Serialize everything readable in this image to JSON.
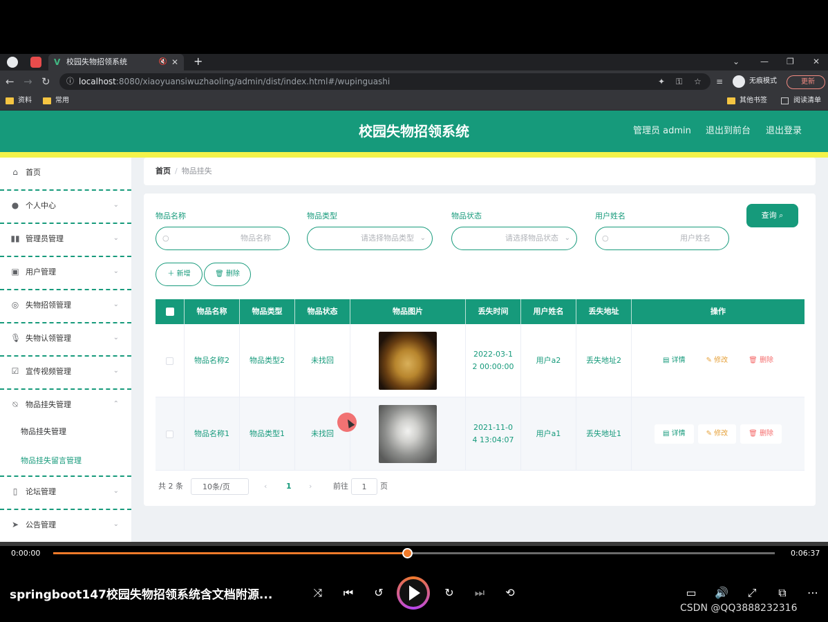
{
  "browser": {
    "tab_title": "校园失物招领系统",
    "url_host": "localhost",
    "url_rest": ":8080/xiaoyuansiwuzhaoling/admin/dist/index.html#/wupinguashi",
    "incognito_label": "无痕模式",
    "update_label": "更新",
    "bookmarks": [
      "资料",
      "常用"
    ],
    "bookmarks_right": [
      "其他书签",
      "阅读清单"
    ]
  },
  "header": {
    "title": "校园失物招领系统",
    "admin_label": "管理员 admin",
    "to_front_label": "退出到前台",
    "logout_label": "退出登录"
  },
  "sidebar": {
    "items": [
      {
        "label": "首页",
        "icon": "home-icon"
      },
      {
        "label": "个人中心",
        "icon": "user-icon"
      },
      {
        "label": "管理员管理",
        "icon": "bars-icon"
      },
      {
        "label": "用户管理",
        "icon": "clipboard-icon"
      },
      {
        "label": "失物招领管理",
        "icon": "target-icon"
      },
      {
        "label": "失物认领管理",
        "icon": "mic-icon"
      },
      {
        "label": "宣传视频管理",
        "icon": "checklist-icon"
      },
      {
        "label": "物品挂失管理",
        "icon": "bell-off-icon"
      },
      {
        "label": "论坛管理",
        "icon": "phone-icon"
      },
      {
        "label": "公告管理",
        "icon": "send-icon"
      }
    ],
    "sub_items": [
      "物品挂失管理",
      "物品挂失留言管理"
    ]
  },
  "breadcrumb": {
    "home": "首页",
    "separator": "/",
    "current": "物品挂失"
  },
  "search": {
    "fields": [
      {
        "label": "物品名称",
        "placeholder": "物品名称"
      },
      {
        "label": "物品类型",
        "placeholder": "请选择物品类型"
      },
      {
        "label": "物品状态",
        "placeholder": "请选择物品状态"
      },
      {
        "label": "用户姓名",
        "placeholder": "用户姓名"
      }
    ],
    "query_label": "查询 ⌕",
    "add_label": "＋ 新增",
    "delete_label": "🗑 删除"
  },
  "table": {
    "columns": [
      "物品名称",
      "物品类型",
      "物品状态",
      "物品图片",
      "丢失时间",
      "用户姓名",
      "丢失地址",
      "操作"
    ],
    "rows": [
      {
        "name": "物品名称2",
        "type": "物品类型2",
        "status": "未找回",
        "image": "basket-photo",
        "time_a": "2022-03-1",
        "time_b": "2 00:00:00",
        "user": "用户a2",
        "address": "丢失地址2"
      },
      {
        "name": "物品名称1",
        "type": "物品类型1",
        "status": "未找回",
        "image": "iron-photo",
        "time_a": "2021-11-0",
        "time_b": "4 13:04:07",
        "user": "用户a1",
        "address": "丢失地址1"
      }
    ],
    "actions": {
      "detail": "▤ 详情",
      "edit": "✎ 修改",
      "delete": "🗑 删除"
    }
  },
  "pager": {
    "total": "共 2 条",
    "page_size": "10条/页",
    "prev": "‹",
    "current": "1",
    "next": "›",
    "goto": "前往",
    "goto_value": "1",
    "page_unit": "页"
  },
  "player": {
    "elapsed": "0:00:00",
    "duration": "0:06:37",
    "progress": 0.49,
    "title": "springboot147校园失物招领系统含文档附源...",
    "watermark": "CSDN @QQ3888232316"
  },
  "colors": {
    "primary": "#169a7b",
    "stripe": "#f4f34a",
    "warning": "#e6a23c",
    "danger": "#f56c6c"
  }
}
